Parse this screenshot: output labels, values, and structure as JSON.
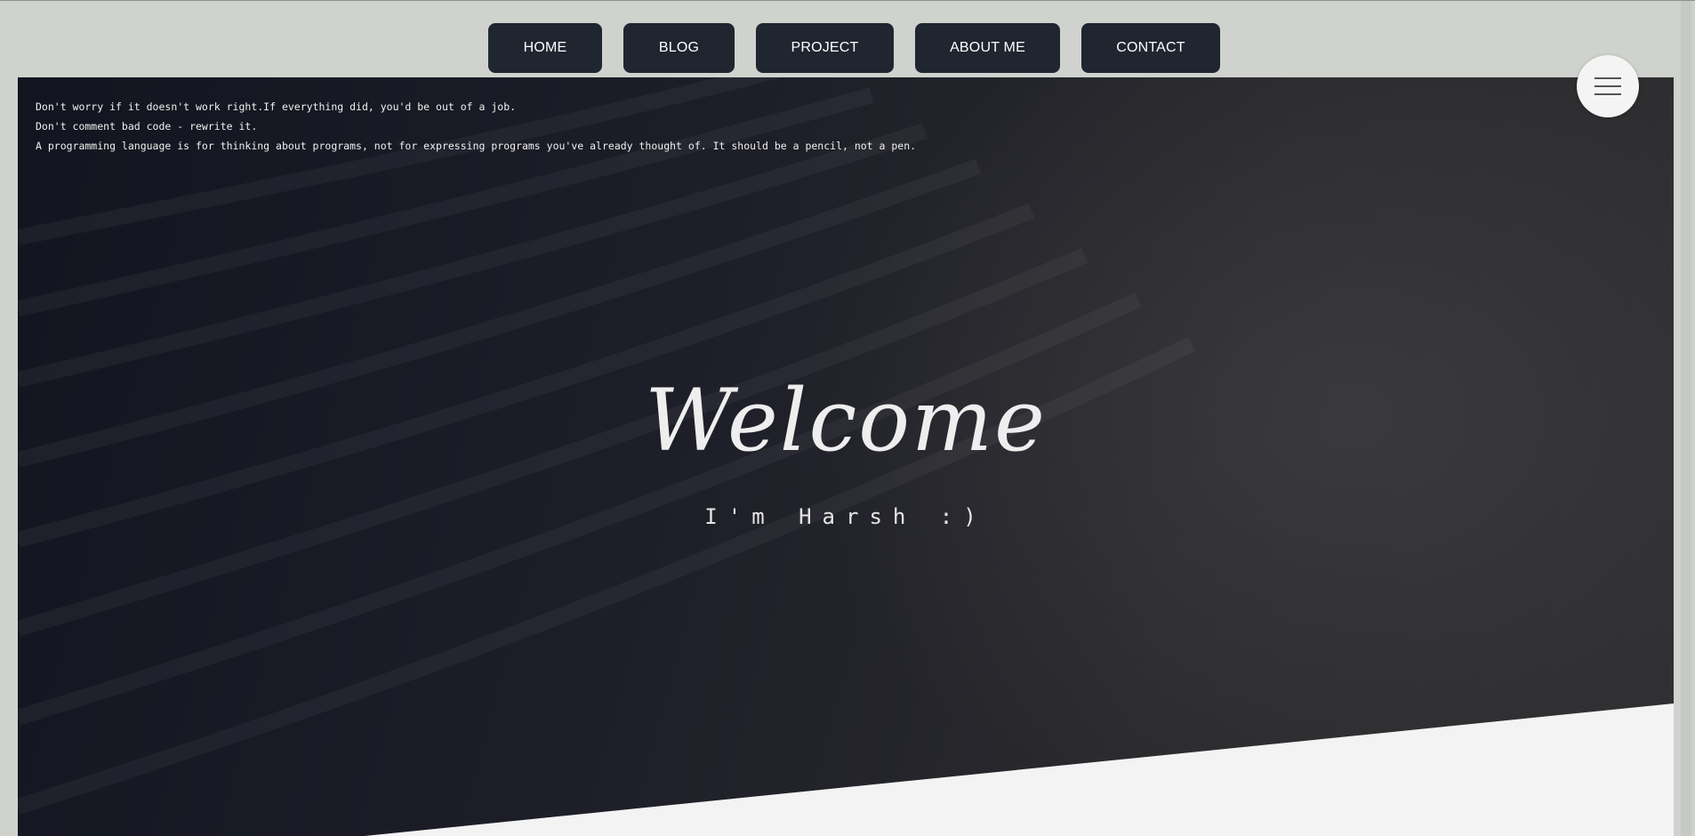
{
  "nav": {
    "items": [
      {
        "label": "HOME"
      },
      {
        "label": "BLOG"
      },
      {
        "label": "PROJECT"
      },
      {
        "label": "ABOUT ME"
      },
      {
        "label": "CONTACT"
      }
    ]
  },
  "hero": {
    "quotes": [
      "Don't worry if it doesn't work right.If everything did, you'd be out of a job.",
      "Don't comment bad code - rewrite it.",
      "A programming language is for thinking about programs, not for expressing programs you've already thought of. It should be a pencil, not a pen."
    ],
    "title": "Welcome",
    "subtitle": "I'm Harsh :)"
  },
  "menu": {
    "icon": "hamburger-menu-icon"
  },
  "colors": {
    "page_bg": "#cfd2cd",
    "nav_button_bg": "#1f2630",
    "nav_button_text": "#ffffff",
    "hero_dark": "#16171f",
    "lower_section_bg": "#f3f3f3",
    "menu_button_bg": "#f4f4f4"
  }
}
